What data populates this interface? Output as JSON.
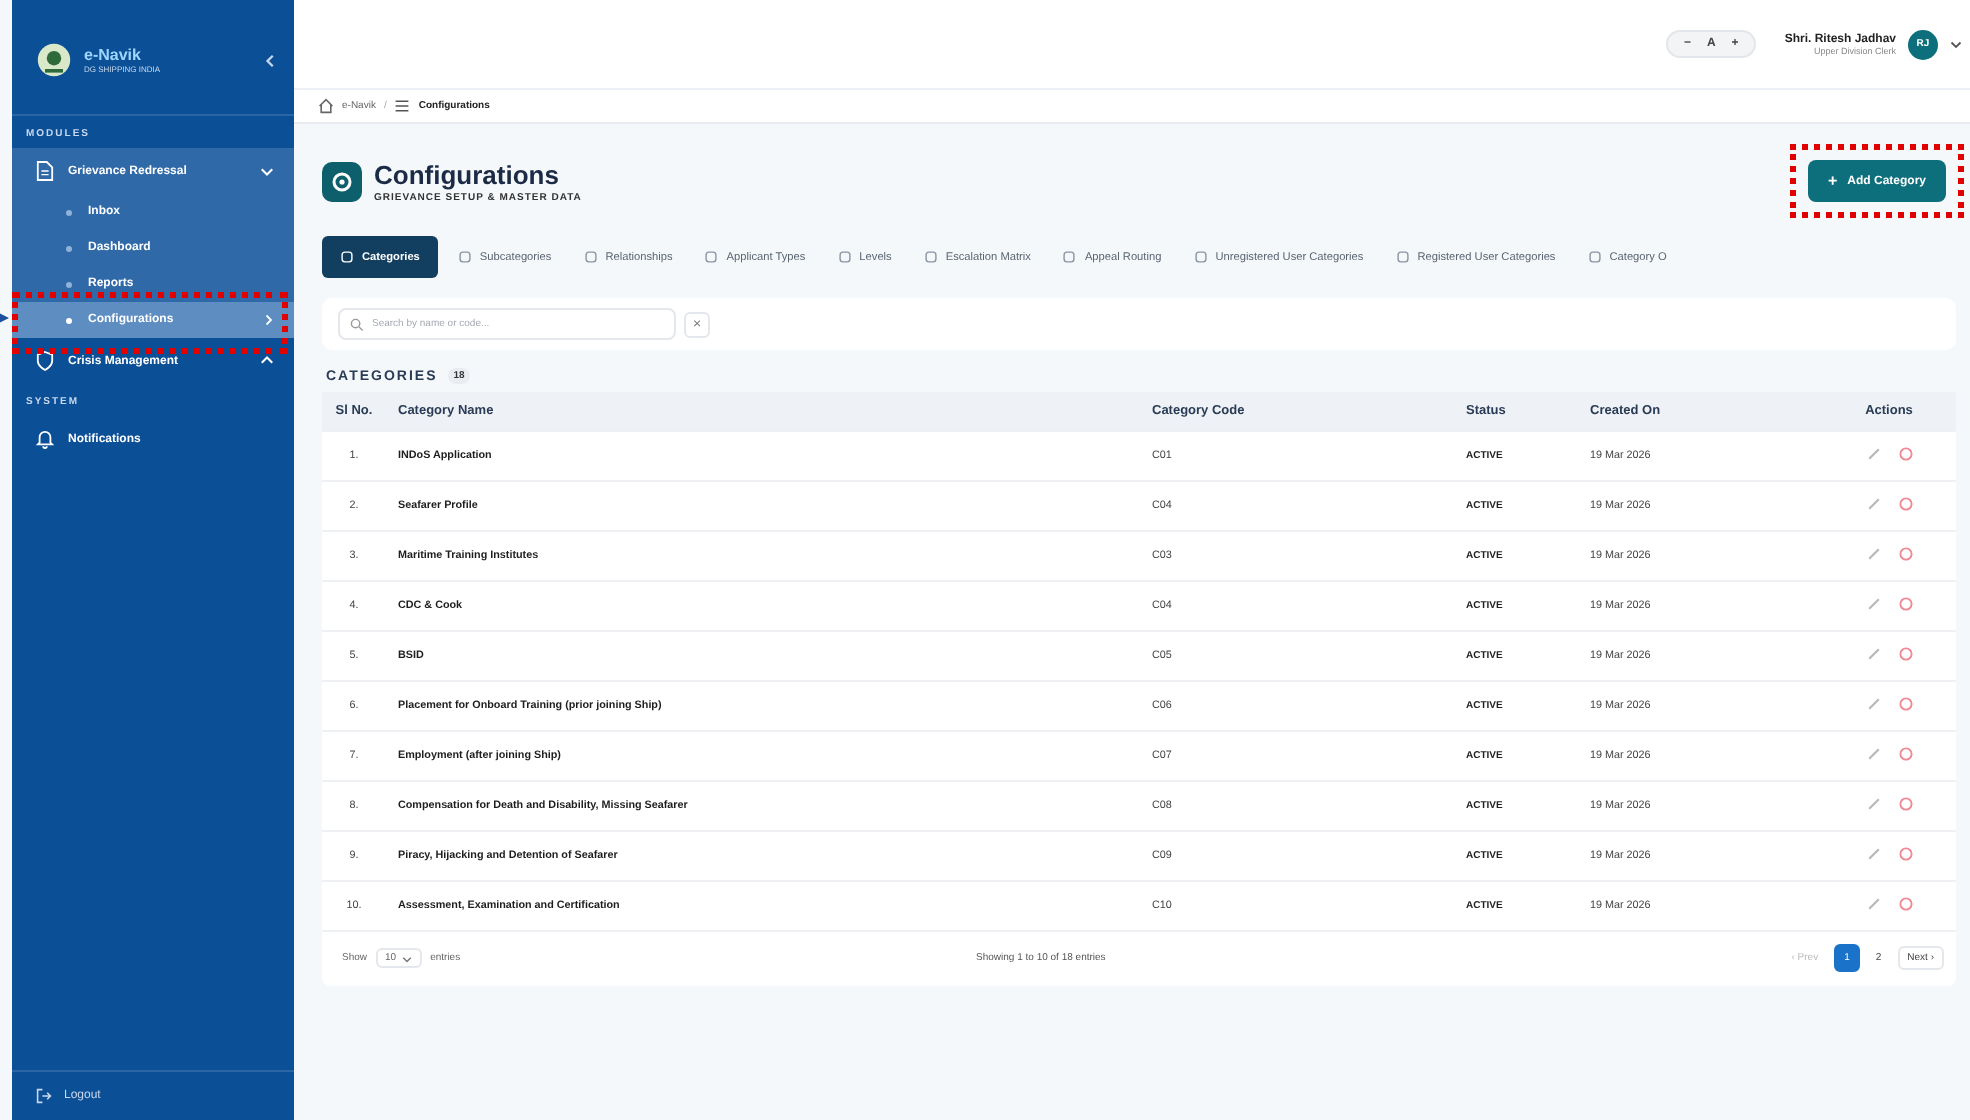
{
  "sidebar": {
    "brand": {
      "name": "e-Navik",
      "tagline": "DG SHIPPING INDIA"
    },
    "sections": [
      {
        "title": "MODULES",
        "items": [
          {
            "label": "Grievance Redressal",
            "kind": "document",
            "expanded": true,
            "children": [
              {
                "label": "Inbox",
                "selected": false
              },
              {
                "label": "Dashboard",
                "selected": false
              },
              {
                "label": "Reports",
                "selected": false
              },
              {
                "label": "Configurations",
                "selected": true
              }
            ]
          },
          {
            "label": "Crisis Management",
            "kind": "shield",
            "expanded": false
          }
        ]
      },
      {
        "title": "SYSTEM",
        "items": [
          {
            "label": "Notifications",
            "kind": "bell"
          }
        ]
      }
    ],
    "logout": "Logout"
  },
  "header": {
    "font_controls": [
      "−",
      "A",
      "+"
    ],
    "user": {
      "name": "Shri. Ritesh Jadhav",
      "role": "Upper Division Clerk",
      "initials": "RJ"
    }
  },
  "breadcrumb": [
    "e-Navik",
    "Configurations"
  ],
  "breadcrumb_separator": "/",
  "page": {
    "title": "Configurations",
    "subtitle": "GRIEVANCE SETUP & MASTER DATA",
    "add_button": "Add Category",
    "add_icon": "+"
  },
  "tabs": [
    {
      "label": "Categories",
      "selected": true
    },
    {
      "label": "Subcategories",
      "selected": false
    },
    {
      "label": "Relationships",
      "selected": false
    },
    {
      "label": "Applicant Types",
      "selected": false
    },
    {
      "label": "Levels",
      "selected": false
    },
    {
      "label": "Escalation Matrix",
      "selected": false
    },
    {
      "label": "Appeal Routing",
      "selected": false
    },
    {
      "label": "Unregistered User Categories",
      "selected": false
    },
    {
      "label": "Registered User Categories",
      "selected": false
    },
    {
      "label": "Category O",
      "selected": false
    }
  ],
  "search": {
    "placeholder": "Search by name or code...",
    "clear": "×"
  },
  "section": {
    "title": "CATEGORIES",
    "count": "18"
  },
  "table": {
    "columns": [
      "Sl No.",
      "Category Name",
      "Category Code",
      "Status",
      "Created On",
      "Actions"
    ],
    "rows": [
      {
        "no": "1.",
        "name": "INDoS Application",
        "code": "C01",
        "status": "ACTIVE",
        "created": "19 Mar 2026"
      },
      {
        "no": "2.",
        "name": "Seafarer Profile",
        "code": "C04",
        "status": "ACTIVE",
        "created": "19 Mar 2026"
      },
      {
        "no": "3.",
        "name": "Maritime Training Institutes",
        "code": "C03",
        "status": "ACTIVE",
        "created": "19 Mar 2026"
      },
      {
        "no": "4.",
        "name": "CDC & Cook",
        "code": "C04",
        "status": "ACTIVE",
        "created": "19 Mar 2026"
      },
      {
        "no": "5.",
        "name": "BSID",
        "code": "C05",
        "status": "ACTIVE",
        "created": "19 Mar 2026"
      },
      {
        "no": "6.",
        "name": "Placement for Onboard Training (prior joining Ship)",
        "code": "C06",
        "status": "ACTIVE",
        "created": "19 Mar 2026"
      },
      {
        "no": "7.",
        "name": "Employment (after joining Ship)",
        "code": "C07",
        "status": "ACTIVE",
        "created": "19 Mar 2026"
      },
      {
        "no": "8.",
        "name": "Compensation for Death and Disability, Missing Seafarer",
        "code": "C08",
        "status": "ACTIVE",
        "created": "19 Mar 2026"
      },
      {
        "no": "9.",
        "name": "Piracy, Hijacking and Detention of Seafarer",
        "code": "C09",
        "status": "ACTIVE",
        "created": "19 Mar 2026"
      },
      {
        "no": "10.",
        "name": "Assessment, Examination and Certification",
        "code": "C10",
        "status": "ACTIVE",
        "created": "19 Mar 2026"
      }
    ]
  },
  "footer": {
    "show": "Show",
    "page_size": "10",
    "entries": "entries",
    "summary": "Showing 1 to 10 of 18 entries",
    "pages": [
      {
        "label": "‹ Prev",
        "kind": "prev",
        "disabled": true,
        "selected": false
      },
      {
        "label": "1",
        "kind": "page",
        "disabled": false,
        "selected": true
      },
      {
        "label": "2",
        "kind": "page",
        "disabled": false,
        "selected": false
      },
      {
        "label": "Next ›",
        "kind": "next",
        "disabled": false,
        "selected": false
      }
    ]
  }
}
